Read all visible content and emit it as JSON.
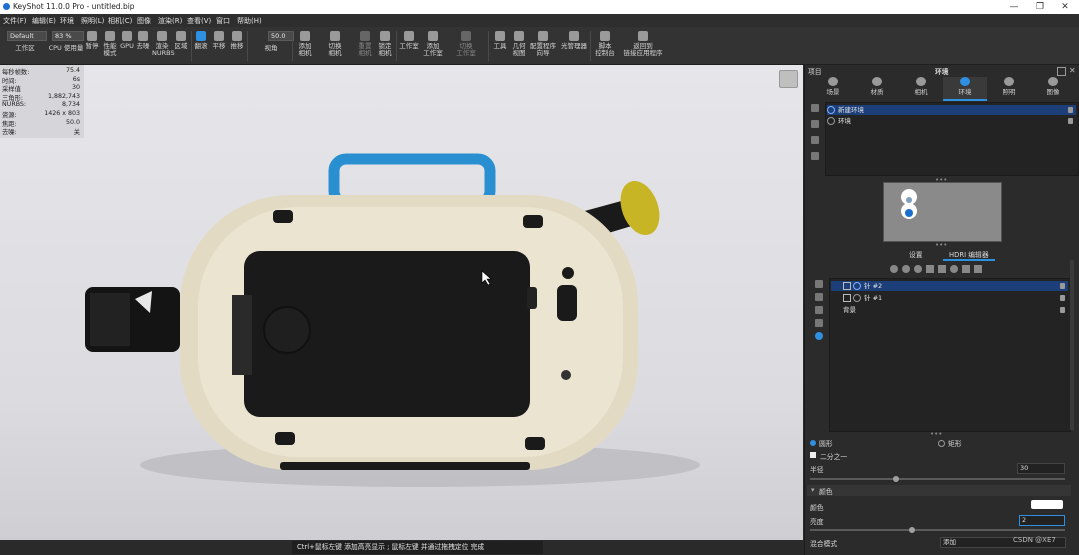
{
  "titlebar": {
    "title": "KeyShot 11.0.0 Pro  -  untitled.bip",
    "min": "—",
    "max": "❐",
    "close": "✕"
  },
  "menu": [
    "文件(F)",
    "编辑(E)",
    "环境",
    "照明(L)",
    "相机(C)",
    "图像",
    "渲染(R)",
    "查看(V)",
    "窗口",
    "帮助(H)"
  ],
  "toolbar": {
    "workspace_select": "Default",
    "workspace_label": "工作区",
    "cpu_value": "83 %",
    "cpu_label": "CPU 使用量",
    "pause": "暂停",
    "perf_mode": "性能\n模式",
    "gpu": "GPU",
    "denoise": "去噪",
    "render_nurbs": "渲染\nNURBS",
    "region": "区域",
    "tumble": "翻滚",
    "pan": "平移",
    "dolly": "推移",
    "fov_value": "50.0",
    "fov_label": "视角",
    "add_camera": "添加\n相机",
    "switch_camera": "切换\n相机",
    "reset_camera": "重置\n相机",
    "lock_camera": "锁定\n相机",
    "studio": "工作室",
    "add_studio": "添加\n工作室",
    "switch_studio": "切换\n工作室",
    "tools": "工具",
    "geometry_view": "几何\n视图",
    "config_wizard": "配置程序\n向导",
    "light_manager": "光管理器",
    "script_console": "脚本\n控制台",
    "back_to_app": "返回到\n链接应用程序"
  },
  "stats": [
    {
      "k": "每秒帧数:",
      "v": "75.4"
    },
    {
      "k": "时间:",
      "v": "6s"
    },
    {
      "k": "采样值",
      "v": "30"
    },
    {
      "k": "三角形:",
      "v": "1,882,743"
    },
    {
      "k": "NURBS:",
      "v": "8,734"
    },
    {
      "k": "资源:",
      "v": "1426 x 803"
    },
    {
      "k": "焦距:",
      "v": "50.0"
    },
    {
      "k": "去噪:",
      "v": "关"
    }
  ],
  "status_hint": "Ctrl+鼠标左键 添加高亮显示 ; 鼠标左键 并通过拖拽定位   完成",
  "panel": {
    "project_label": "项目",
    "title": "环境",
    "tabs": [
      "场景",
      "材质",
      "相机",
      "环境",
      "照明",
      "图像"
    ],
    "env_list": [
      {
        "label": "新建环境",
        "selected": true
      },
      {
        "label": "环境",
        "selected": false
      }
    ],
    "subtabs": [
      "设置",
      "HDRI 编辑器"
    ],
    "pins": [
      {
        "label": "针 #2",
        "selected": true
      },
      {
        "label": "针 #1",
        "selected": false
      },
      {
        "label": "背景",
        "selected": false
      }
    ],
    "shape_circle": "圆形",
    "shape_rect": "矩形",
    "half_label": "二分之一",
    "radius_label": "半径",
    "radius_value": "30",
    "color_section": "颜色",
    "color_label": "颜色",
    "brightness_label": "亮度",
    "brightness_value": "2",
    "blend_label": "混合模式",
    "blend_value": "添加",
    "watermark": "CSDN @XE7",
    "accent": "#2f8fe0"
  }
}
